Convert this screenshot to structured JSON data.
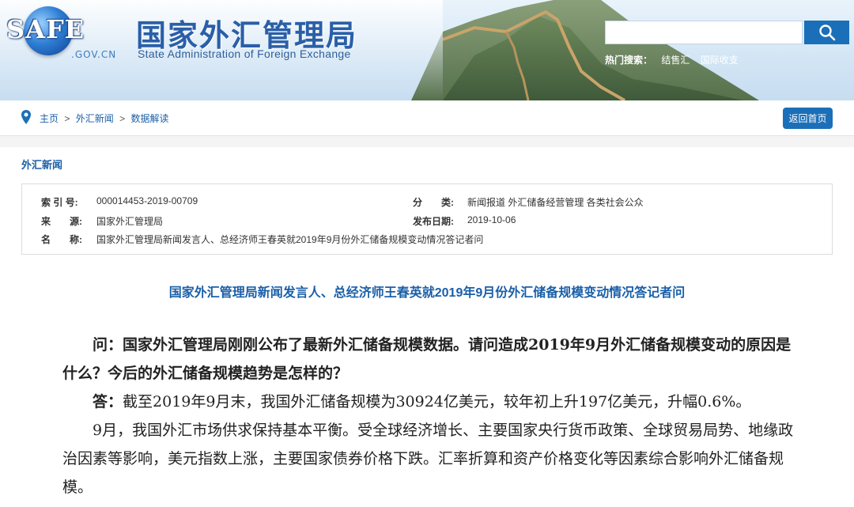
{
  "header": {
    "logo_text": "SAFE",
    "logo_domain": ".GOV.CN",
    "title_cn": "国家外汇管理局",
    "title_en": "State Administration of Foreign Exchange",
    "search_placeholder": "",
    "hot_label": "热门搜索：",
    "hot_links": [
      "结售汇",
      "国际收支"
    ],
    "colors": {
      "brand_blue": "#1b6fb8",
      "title_blue": "#2a5fa8"
    }
  },
  "breadcrumb": {
    "items": [
      "主页",
      "外汇新闻",
      "数据解读"
    ],
    "separator": ">",
    "back_label": "返回首页"
  },
  "section": {
    "title": "外汇新闻"
  },
  "meta": {
    "index_label": "索 引 号:",
    "index_value": "000014453-2019-00709",
    "category_label": "分　　类:",
    "category_value": "新闻报道  外汇储备经营管理  各类社会公众",
    "source_label": "来　　源:",
    "source_value": "国家外汇管理局",
    "date_label": "发布日期:",
    "date_value": "2019-10-06",
    "name_label": "名　　称:",
    "name_value": "国家外汇管理局新闻发言人、总经济师王春英就2019年9月份外汇储备规模变动情况答记者问"
  },
  "article": {
    "title": "国家外汇管理局新闻发言人、总经济师王春英就2019年9月份外汇储备规模变动情况答记者问",
    "question": "问：国家外汇管理局刚刚公布了最新外汇储备规模数据。请问造成2019年9月外汇储备规模变动的原因是什么？今后的外汇储备规模趋势是怎样的？",
    "answer_label": "答：",
    "answer_text": "截至2019年9月末，我国外汇储备规模为30924亿美元，较年初上升197亿美元，升幅0.6%。",
    "paragraph": "9月，我国外汇市场供求保持基本平衡。受全球经济增长、主要国家央行货币政策、全球贸易局势、地缘政治因素等影响，美元指数上涨，主要国家债券价格下跌。汇率折算和资产价格变化等因素综合影响外汇储备规模。"
  }
}
